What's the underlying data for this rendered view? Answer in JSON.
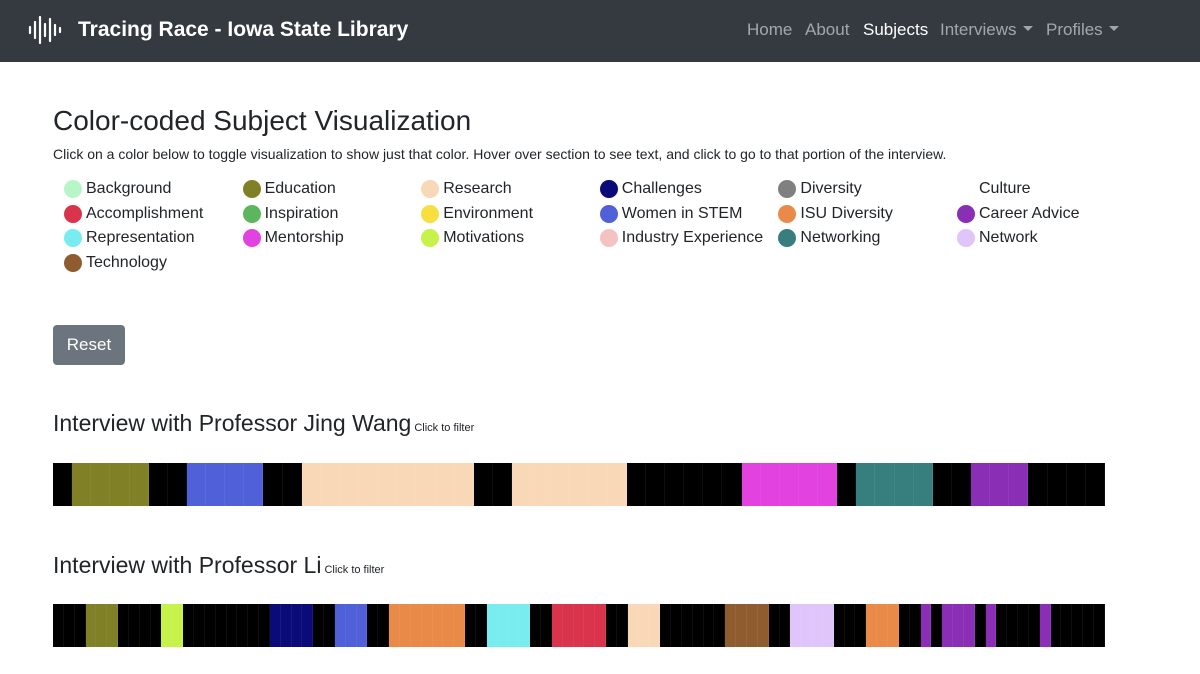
{
  "navbar": {
    "brand": "Tracing Race - Iowa State Library",
    "brand_icon": "soundwave-icon",
    "items": [
      {
        "label": "Home",
        "active": false,
        "dropdown": false
      },
      {
        "label": "About",
        "active": false,
        "dropdown": false
      },
      {
        "label": "Subjects",
        "active": true,
        "dropdown": false
      },
      {
        "label": "Interviews",
        "active": false,
        "dropdown": true
      },
      {
        "label": "Profiles",
        "active": false,
        "dropdown": true
      }
    ]
  },
  "page": {
    "title": "Color-coded Subject Visualization",
    "description": "Click on a color below to toggle visualization to show just that color. Hover over section to see text, and click to go to that portion of the interview."
  },
  "legend": [
    {
      "label": "Background",
      "color": "#b8f5c8"
    },
    {
      "label": "Education",
      "color": "#808026"
    },
    {
      "label": "Research",
      "color": "#f9d8b8"
    },
    {
      "label": "Challenges",
      "color": "#0a0a78"
    },
    {
      "label": "Diversity",
      "color": "#808080"
    },
    {
      "label": "Culture",
      "color": "#ffffff"
    },
    {
      "label": "Accomplishment",
      "color": "#d9344b"
    },
    {
      "label": "Inspiration",
      "color": "#5db55d"
    },
    {
      "label": "Environment",
      "color": "#f7de41"
    },
    {
      "label": "Women in STEM",
      "color": "#4f60d9"
    },
    {
      "label": "ISU Diversity",
      "color": "#ea8a48"
    },
    {
      "label": "Career Advice",
      "color": "#8a2fb5"
    },
    {
      "label": "Representation",
      "color": "#78ecef"
    },
    {
      "label": "Mentorship",
      "color": "#e142e0"
    },
    {
      "label": "Motivations",
      "color": "#c6f249"
    },
    {
      "label": "Industry Experience",
      "color": "#f5c2c2"
    },
    {
      "label": "Networking",
      "color": "#367f7e"
    },
    {
      "label": "Network",
      "color": "#e0c5fa"
    },
    {
      "label": "Technology",
      "color": "#8f5c30"
    }
  ],
  "reset_label": "Reset",
  "interviews": [
    {
      "title": "Interview with Professor Jing Wang",
      "hint": "Click to filter",
      "segments": [
        "#000000",
        "#808026",
        "#808026",
        "#808026",
        "#808026",
        "#000000",
        "#000000",
        "#4f60d9",
        "#4f60d9",
        "#4f60d9",
        "#4f60d9",
        "#000000",
        "#000000",
        "#f9d8b8",
        "#f9d8b8",
        "#f9d8b8",
        "#f9d8b8",
        "#f9d8b8",
        "#f9d8b8",
        "#f9d8b8",
        "#f9d8b8",
        "#f9d8b8",
        "#000000",
        "#000000",
        "#f9d8b8",
        "#f9d8b8",
        "#f9d8b8",
        "#f9d8b8",
        "#f9d8b8",
        "#f9d8b8",
        "#000000",
        "#000000",
        "#000000",
        "#000000",
        "#000000",
        "#000000",
        "#e142e0",
        "#e142e0",
        "#e142e0",
        "#e142e0",
        "#e142e0",
        "#000000",
        "#367f7e",
        "#367f7e",
        "#367f7e",
        "#367f7e",
        "#000000",
        "#000000",
        "#8a2fb5",
        "#8a2fb5",
        "#8a2fb5",
        "#000000",
        "#000000",
        "#000000",
        "#000000"
      ]
    },
    {
      "title": "Interview with Professor Li",
      "hint": "Click to filter",
      "segments": [
        "#000000",
        "#000000",
        "#000000",
        "#808026",
        "#808026",
        "#808026",
        "#000000",
        "#000000",
        "#000000",
        "#000000",
        "#c6f249",
        "#c6f249",
        "#000000",
        "#000000",
        "#000000",
        "#000000",
        "#000000",
        "#000000",
        "#000000",
        "#000000",
        "#0a0a78",
        "#0a0a78",
        "#0a0a78",
        "#0a0a78",
        "#000000",
        "#000000",
        "#4f60d9",
        "#4f60d9",
        "#4f60d9",
        "#000000",
        "#000000",
        "#ea8a48",
        "#ea8a48",
        "#ea8a48",
        "#ea8a48",
        "#ea8a48",
        "#ea8a48",
        "#ea8a48",
        "#000000",
        "#000000",
        "#78ecef",
        "#78ecef",
        "#78ecef",
        "#78ecef",
        "#000000",
        "#000000",
        "#d9344b",
        "#d9344b",
        "#d9344b",
        "#d9344b",
        "#d9344b",
        "#000000",
        "#000000",
        "#f9d8b8",
        "#f9d8b8",
        "#f9d8b8",
        "#000000",
        "#000000",
        "#000000",
        "#000000",
        "#000000",
        "#000000",
        "#8f5c30",
        "#8f5c30",
        "#8f5c30",
        "#8f5c30",
        "#000000",
        "#000000",
        "#e0c5fa",
        "#e0c5fa",
        "#e0c5fa",
        "#e0c5fa",
        "#000000",
        "#000000",
        "#000000",
        "#ea8a48",
        "#ea8a48",
        "#ea8a48",
        "#000000",
        "#000000",
        "#8a2fb5",
        "#000000",
        "#8a2fb5",
        "#8a2fb5",
        "#8a2fb5",
        "#000000",
        "#8a2fb5",
        "#000000",
        "#000000",
        "#000000",
        "#000000",
        "#8a2fb5",
        "#000000",
        "#000000",
        "#000000",
        "#000000",
        "#000000"
      ]
    }
  ]
}
